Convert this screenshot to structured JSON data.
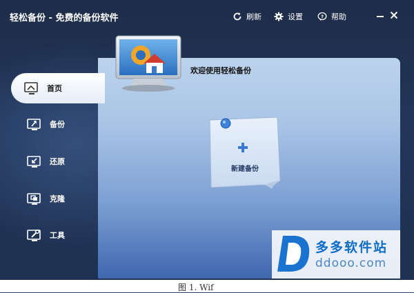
{
  "app": {
    "title": "轻松备份 - 免费的备份软件"
  },
  "toolbar": {
    "refresh_label": "刷新",
    "settings_label": "设置",
    "help_label": "帮助"
  },
  "sidebar": {
    "items": [
      {
        "label": "首页",
        "icon": "home-monitor-icon",
        "active": true
      },
      {
        "label": "备份",
        "icon": "backup-monitor-icon",
        "active": false
      },
      {
        "label": "还原",
        "icon": "restore-monitor-icon",
        "active": false
      },
      {
        "label": "克隆",
        "icon": "clone-monitor-icon",
        "active": false
      },
      {
        "label": "工具",
        "icon": "tools-monitor-icon",
        "active": false
      }
    ]
  },
  "main": {
    "welcome": "欢迎使用轻松备份",
    "new_backup_label": "新建备份"
  },
  "watermark": {
    "name": "多多软件站",
    "url": "ddooo.com"
  },
  "footer": {
    "text": "图 1. Wif"
  },
  "colors": {
    "title_bg": "#1d2c48",
    "content_light": "#bcd3ec",
    "content_dark": "#3f67b0",
    "watermark_blue": "#0c6cc9"
  }
}
